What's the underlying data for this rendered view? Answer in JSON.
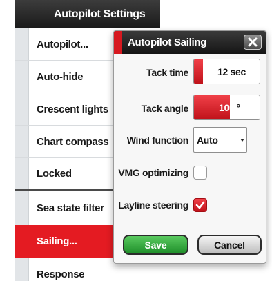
{
  "settings": {
    "title": "Autopilot Settings",
    "items": [
      {
        "label": "Autopilot..."
      },
      {
        "label": "Auto-hide"
      },
      {
        "label": "Crescent lights"
      },
      {
        "label": "Chart compass"
      },
      {
        "label": "Locked"
      },
      {
        "label": "Sea state filter"
      },
      {
        "label": "Sailing..."
      },
      {
        "label": "Response"
      }
    ],
    "selected_index": 6
  },
  "dialog": {
    "title": "Autopilot Sailing",
    "tack_time": {
      "label": "Tack time",
      "value": "12 sec",
      "fill_fraction": 0.14
    },
    "tack_angle": {
      "label": "Tack angle",
      "value": "100",
      "unit": "°",
      "fill_fraction": 0.55
    },
    "wind_function": {
      "label": "Wind function",
      "value": "Auto"
    },
    "vmg_optimizing": {
      "label": "VMG optimizing",
      "checked": false
    },
    "layline_steering": {
      "label": "Layline steering",
      "checked": true
    },
    "save_label": "Save",
    "cancel_label": "Cancel"
  },
  "colors": {
    "accent_red": "#e41b22",
    "save_green": "#2ea83a",
    "header_dark": "#1a1a1a"
  }
}
